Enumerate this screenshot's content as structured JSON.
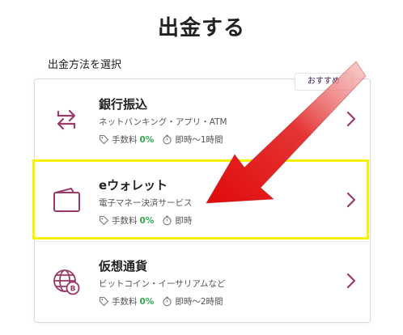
{
  "page": {
    "title": "出金する",
    "section_label": "出金方法を選択"
  },
  "badge": "おすすめ",
  "colors": {
    "accent": "#9a3a6b",
    "fee_green": "#2fa84f",
    "highlight": "#f5f500",
    "arrow": "#e01818"
  },
  "methods": [
    {
      "name": "銀行振込",
      "subtitle": "ネットバンキング・アプリ・ATM",
      "fee_label": "手数料",
      "fee_value": "0%",
      "time": "即時〜1時間",
      "icon": "bank-transfer-arrows-icon"
    },
    {
      "name": "eウォレット",
      "subtitle": "電子マネー決済サービス",
      "fee_label": "手数料",
      "fee_value": "0%",
      "time": "即時",
      "icon": "wallet-icon"
    },
    {
      "name": "仮想通貨",
      "subtitle": "ビットコイン・イーサリアムなど",
      "fee_label": "手数料",
      "fee_value": "0%",
      "time": "即時〜2時間",
      "icon": "crypto-globe-icon"
    }
  ]
}
